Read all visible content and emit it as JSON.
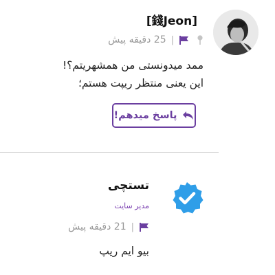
{
  "comment_1": {
    "author": "[錢Jeon]",
    "time": "25 دقیقه پیش",
    "separator": "|",
    "lines": [
      "ممد میدونستی من همشهریتم؟!",
      "این یعنی منتظر ریپت هستم؛"
    ],
    "reply_button_label": "پاسخ میدهم!",
    "icons": {
      "avatar": "user-avatar-photo",
      "pin": "pin-icon",
      "flag": "flag-icon",
      "reply": "reply-arrow-icon"
    }
  },
  "comment_2": {
    "author": "تستچی",
    "role": "مدیر سایت",
    "time": "21 دقیقه پیش",
    "separator": "|",
    "text": "بیو ایم ریپ",
    "icons": {
      "badge": "verified-badge-icon",
      "flag": "flag-icon"
    }
  },
  "colors": {
    "accent": "#6b3fa0",
    "badge": "#2f9ee8",
    "muted": "#9a9a9a"
  }
}
